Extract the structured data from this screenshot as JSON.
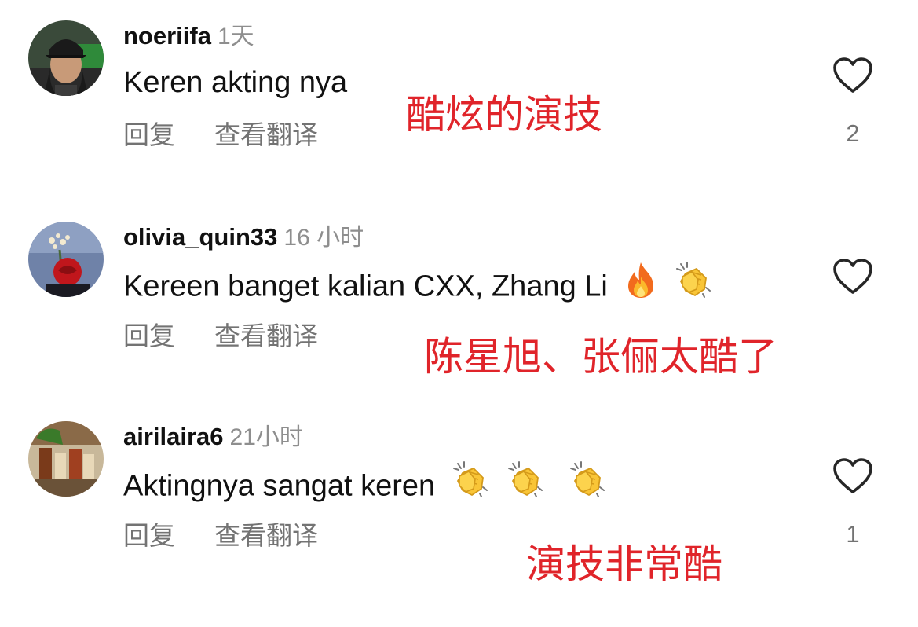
{
  "comments": [
    {
      "username": "noeriifa",
      "time": "1天",
      "text": "Keren akting nya",
      "emojis": [],
      "reply_label": "回复",
      "translate_label": "查看翻译",
      "likes": "2"
    },
    {
      "username": "olivia_quin33",
      "time": "16 小时",
      "text": "Kereen banget kalian CXX, Zhang Li",
      "emojis": [
        "fire-emoji",
        "clapping-hands-emoji"
      ],
      "reply_label": "回复",
      "translate_label": "查看翻译",
      "likes": ""
    },
    {
      "username": "airilaira6",
      "time": "21小时",
      "text": "Aktingnya sangat keren",
      "emojis": [
        "clapping-hands-emoji",
        "clapping-hands-emoji",
        "clapping-hands-emoji"
      ],
      "reply_label": "回复",
      "translate_label": "查看翻译",
      "likes": "1"
    }
  ],
  "annotations": [
    "酷炫的演技",
    "陈星旭、张俪太酷了",
    "演技非常酷"
  ],
  "colors": {
    "username": "#111111",
    "secondary_text": "#8e8e8e",
    "action_text": "#737373",
    "annotation": "#e0242a",
    "heart_outline": "#262626"
  },
  "icons": {
    "like": "heart-outline-icon"
  }
}
